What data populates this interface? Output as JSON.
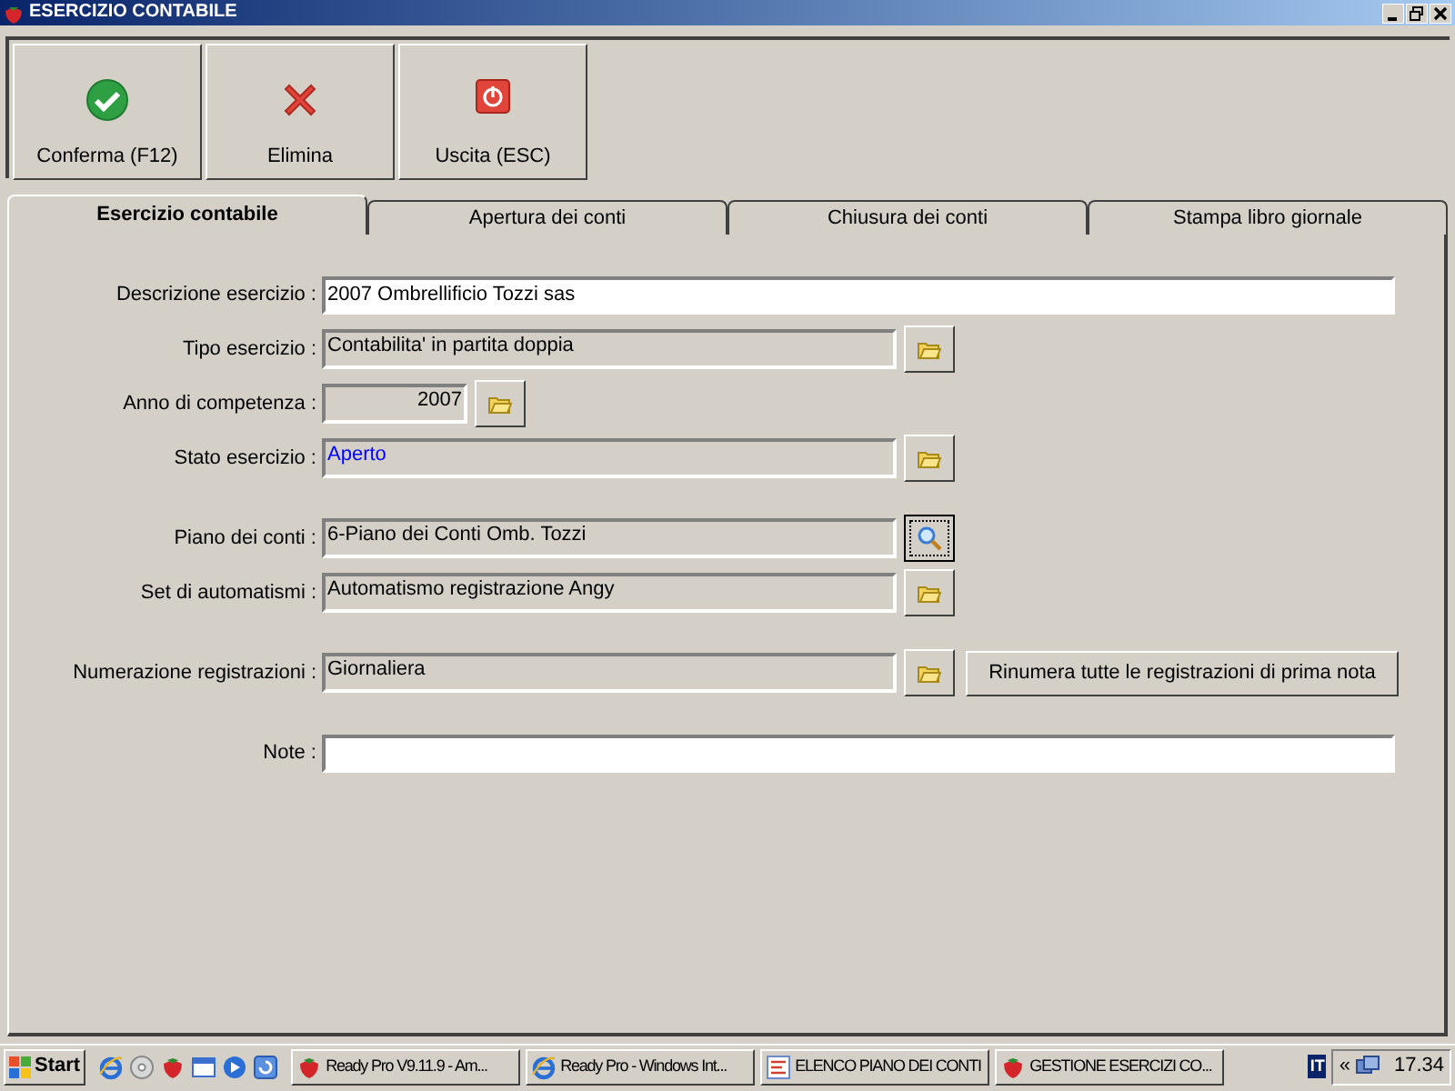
{
  "window": {
    "title": "ESERCIZIO CONTABILE"
  },
  "toolbar": [
    {
      "label": "Conferma (F12)"
    },
    {
      "label": "Elimina"
    },
    {
      "label": "Uscita (ESC)"
    }
  ],
  "tabs": [
    {
      "label": "Esercizio contabile",
      "selected": true
    },
    {
      "label": "Apertura dei conti",
      "selected": false
    },
    {
      "label": "Chiusura dei conti",
      "selected": false
    },
    {
      "label": "Stampa libro giornale",
      "selected": false
    }
  ],
  "sections": [
    [
      {
        "label": "Descrizione esercizio :",
        "kind": "text",
        "value": "2007 Ombrellificio Tozzi sas"
      },
      {
        "label": "Tipo esercizio :",
        "kind": "lookup",
        "value": "Contabilita' in partita doppia",
        "color": "#000000",
        "focused": false
      },
      {
        "label": "Anno di competenza :",
        "kind": "year",
        "value": "2007",
        "focused": false
      },
      {
        "label": "Stato esercizio :",
        "kind": "lookup",
        "value": "Aperto",
        "color": "#0000ff",
        "focused": false
      }
    ],
    [
      {
        "label": "Piano dei conti :",
        "kind": "search",
        "value": "6-Piano dei Conti Omb. Tozzi",
        "color": "#000000",
        "focused": true
      },
      {
        "label": "Set di automatismi :",
        "kind": "lookup",
        "value": "Automatismo registrazione Angy",
        "color": "#000000",
        "focused": false
      }
    ],
    [
      {
        "label": "Numerazione registrazioni :",
        "kind": "lookup",
        "value": "Giornaliera",
        "color": "#000000",
        "focused": false,
        "action": "Rinumera tutte le registrazioni di prima nota"
      }
    ],
    [
      {
        "label": "Note :",
        "kind": "text"
      }
    ]
  ],
  "taskbar": {
    "start": "Start",
    "tasks": [
      {
        "label": "Ready Pro V9.11.9 - Am..."
      },
      {
        "label": "Ready Pro - Windows Int..."
      },
      {
        "label": "ELENCO PIANO DEI CONTI"
      },
      {
        "label": "GESTIONE ESERCIZI CO..."
      }
    ],
    "tray": {
      "language": "IT",
      "expand": "«",
      "clock": "17.34"
    }
  }
}
